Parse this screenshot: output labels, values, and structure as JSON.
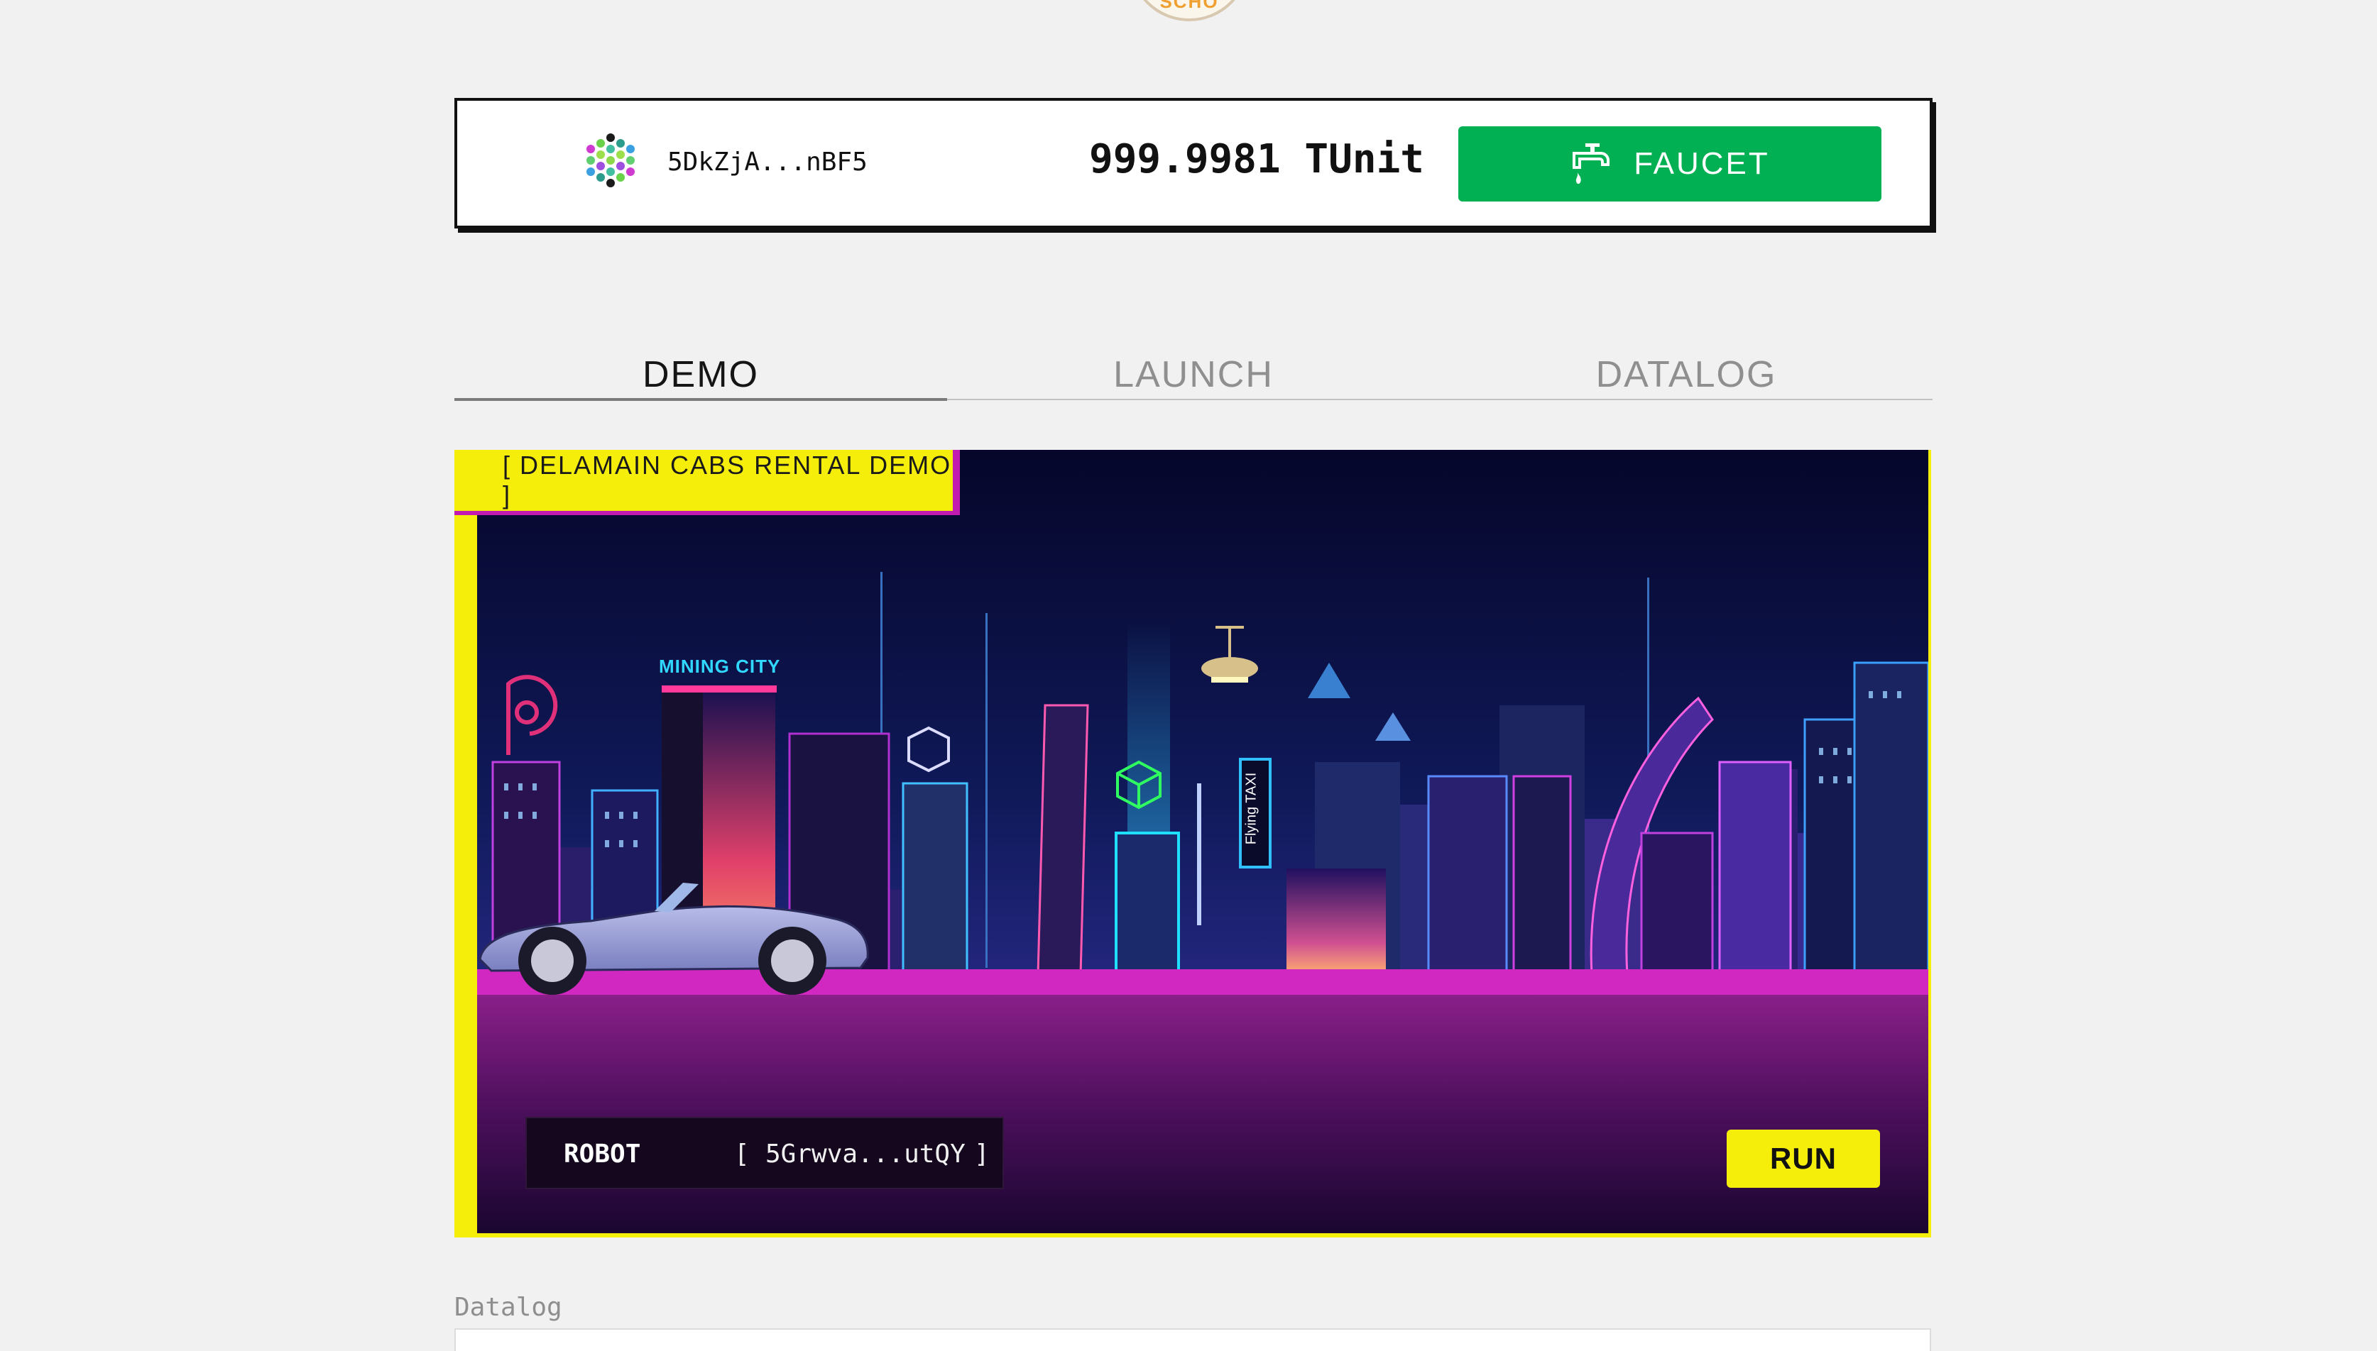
{
  "logo": {
    "text": "SCHO"
  },
  "account": {
    "address": "5DkZjA...nBF5",
    "balance": "999.9981 TUnit",
    "faucet_label": "FAUCET"
  },
  "tabs": [
    {
      "label": "DEMO",
      "active": true
    },
    {
      "label": "LAUNCH",
      "active": false
    },
    {
      "label": "DATALOG",
      "active": false
    }
  ],
  "demo": {
    "title": "[ DELAMAIN CABS RENTAL DEMO ]",
    "sign_mining_city": "MINING CITY",
    "sign_flying_taxi": "Flying TAXI",
    "robot_label": "ROBOT",
    "robot_open": "[",
    "robot_address": "5Grwva...utQY",
    "robot_close": "]",
    "run_label": "RUN"
  },
  "datalog": {
    "label": "Datalog"
  },
  "colors": {
    "accent_yellow": "#f4ee0a",
    "faucet_green": "#00b052",
    "neon_magenta": "#c21bb0"
  }
}
